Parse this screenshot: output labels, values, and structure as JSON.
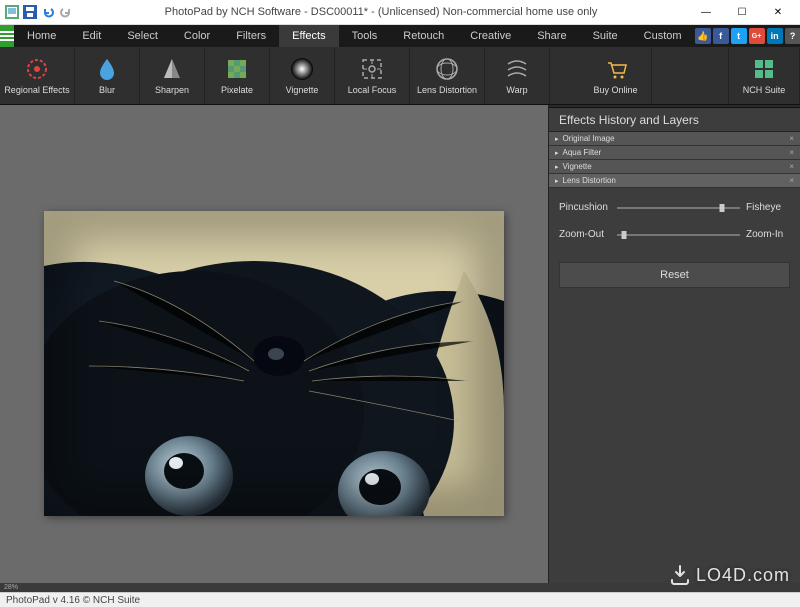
{
  "title": "PhotoPad by NCH Software - DSC00011* - (Unlicensed) Non-commercial home use only",
  "menu": {
    "items": [
      {
        "label": "Home"
      },
      {
        "label": "Edit"
      },
      {
        "label": "Select"
      },
      {
        "label": "Color"
      },
      {
        "label": "Filters"
      },
      {
        "label": "Effects",
        "active": true
      },
      {
        "label": "Tools"
      },
      {
        "label": "Retouch"
      },
      {
        "label": "Creative"
      },
      {
        "label": "Share"
      },
      {
        "label": "Suite"
      },
      {
        "label": "Custom"
      }
    ]
  },
  "toolbar": {
    "items": [
      {
        "label": "Regional Effects",
        "icon": "regional"
      },
      {
        "label": "Blur",
        "icon": "blur"
      },
      {
        "label": "Sharpen",
        "icon": "sharpen"
      },
      {
        "label": "Pixelate",
        "icon": "pixelate"
      },
      {
        "label": "Vignette",
        "icon": "vignette"
      },
      {
        "label": "Local Focus",
        "icon": "localfocus"
      },
      {
        "label": "Lens Distortion",
        "icon": "lensdist"
      },
      {
        "label": "Warp",
        "icon": "warp"
      }
    ],
    "buy": "Buy Online",
    "suite": "NCH Suite"
  },
  "panel": {
    "title": "Effects History and Layers",
    "layers": [
      {
        "label": "Original Image"
      },
      {
        "label": "Aqua Filter"
      },
      {
        "label": "Vignette"
      },
      {
        "label": "Lens Distortion",
        "selected": true
      }
    ],
    "slider1": {
      "left": "Pincushion",
      "right": "Fisheye",
      "pos": 85
    },
    "slider2": {
      "left": "Zoom-Out",
      "right": "Zoom-In",
      "pos": 6
    },
    "reset": "Reset"
  },
  "zoom": "28%",
  "status": "PhotoPad v 4.16 © NCH Suite",
  "watermark": "LO4D.com",
  "social": {
    "thumb": "👍",
    "fb": {
      "bg": "#3b5998",
      "t": "f"
    },
    "tw": {
      "bg": "#1da1f2",
      "t": "t"
    },
    "gp": {
      "bg": "#dd4b39",
      "t": "G+"
    },
    "li": {
      "bg": "#0077b5",
      "t": "in"
    },
    "q": {
      "bg": "#555",
      "t": "?"
    }
  }
}
